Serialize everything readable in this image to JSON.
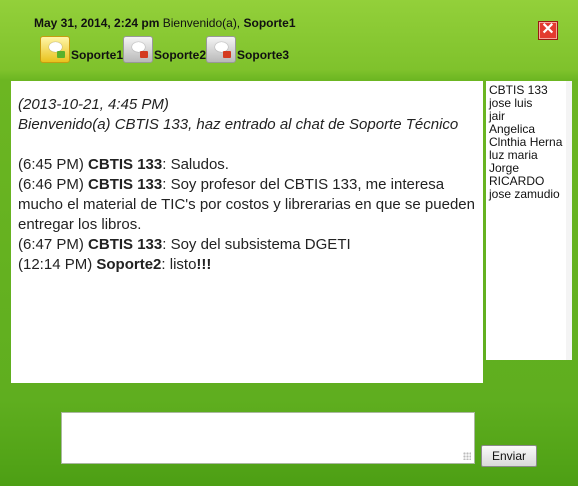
{
  "header": {
    "datetime": "May 31, 2014, 2:24 pm",
    "welcome": "Bienvenido(a),",
    "current_user": "Soporte1",
    "close_label": "✕"
  },
  "support_users": [
    {
      "name": "Soporte1",
      "status": "online"
    },
    {
      "name": "Soporte2",
      "status": "offline"
    },
    {
      "name": "Soporte3",
      "status": "offline"
    }
  ],
  "chat": {
    "intro_time": "(2013-10-21, 4:45 PM)",
    "intro_text": "Bienvenido(a) CBTIS 133, haz entrado al chat de Soporte Técnico",
    "messages": [
      {
        "time": "(6:45 PM)",
        "sender": "CBTIS 133",
        "text": "Saludos."
      },
      {
        "time": "(6:46 PM)",
        "sender": "CBTIS 133",
        "text": "Soy profesor del CBTIS 133, me interesa mucho el material de TIC's por costos y librerarias en que se pueden entregar los libros."
      },
      {
        "time": "(6:47 PM)",
        "sender": "CBTIS 133",
        "text": "Soy del subsistema DGETI"
      },
      {
        "time": "(12:14 PM)",
        "sender": "Soporte2",
        "text": "listo",
        "emph": "!!!"
      }
    ]
  },
  "userlist": [
    "CBTIS 133",
    "jose luis",
    "jair",
    "Angelica",
    "Clnthia Herna",
    "luz maria",
    "Jorge",
    "RICARDO",
    "jose zamudio"
  ],
  "composer": {
    "value": "",
    "send_label": "Enviar"
  },
  "colors": {
    "brand_green": "#7fc22c",
    "close_red": "#e33b2f"
  }
}
